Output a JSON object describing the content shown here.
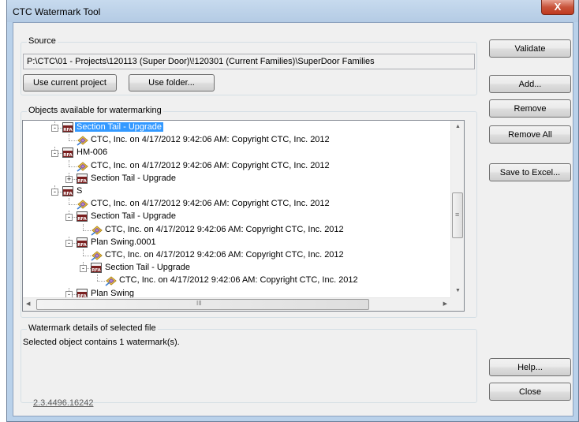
{
  "window": {
    "title": "CTC Watermark Tool",
    "close_glyph": "X"
  },
  "source": {
    "group_label": "Source",
    "path": "P:\\CTC\\01 - Projects\\120113 (Super Door)\\!120301 (Current Families)\\SuperDoor Families",
    "use_current_project_label": "Use current project",
    "use_folder_label": "Use folder..."
  },
  "objects": {
    "group_label": "Objects available for watermarking",
    "tree": [
      {
        "text": "Section Tail - Upgrade",
        "type": "rfa",
        "level": 0,
        "expander": "-",
        "selected": true
      },
      {
        "text": "CTC, Inc. on 4/17/2012 9:42:06 AM: Copyright CTC, Inc. 2012",
        "type": "wm",
        "level": 1
      },
      {
        "text": "HM-006",
        "type": "rfa",
        "level": 0,
        "expander": "-"
      },
      {
        "text": "CTC, Inc. on 4/17/2012 9:42:06 AM: Copyright CTC, Inc. 2012",
        "type": "wm",
        "level": 1
      },
      {
        "text": "Section Tail - Upgrade",
        "type": "rfa",
        "level": 1,
        "expander": "+"
      },
      {
        "text": "S",
        "type": "rfa",
        "level": 0,
        "expander": "-"
      },
      {
        "text": "CTC, Inc. on 4/17/2012 9:42:06 AM: Copyright CTC, Inc. 2012",
        "type": "wm",
        "level": 1
      },
      {
        "text": "Section Tail - Upgrade",
        "type": "rfa",
        "level": 1,
        "expander": "-"
      },
      {
        "text": "CTC, Inc. on 4/17/2012 9:42:06 AM: Copyright CTC, Inc. 2012",
        "type": "wm",
        "level": 2
      },
      {
        "text": "Plan Swing.0001",
        "type": "rfa",
        "level": 1,
        "expander": "-"
      },
      {
        "text": "CTC, Inc. on 4/17/2012 9:42:06 AM: Copyright CTC, Inc. 2012",
        "type": "wm",
        "level": 2
      },
      {
        "text": "Section Tail - Upgrade",
        "type": "rfa",
        "level": 2,
        "expander": "-"
      },
      {
        "text": "CTC, Inc. on 4/17/2012 9:42:06 AM: Copyright CTC, Inc. 2012",
        "type": "wm",
        "level": 3
      },
      {
        "text": "Plan Swing",
        "type": "rfa",
        "level": 1,
        "expander": "-"
      }
    ],
    "hscroll_grip": "III",
    "vscroll_grip": "≡"
  },
  "details": {
    "group_label": "Watermark details of selected file",
    "text": "Selected object contains 1 watermark(s)."
  },
  "buttons": {
    "validate": "Validate",
    "add": "Add...",
    "remove": "Remove",
    "remove_all": "Remove All",
    "save_to_excel": "Save to Excel...",
    "help": "Help...",
    "close": "Close"
  },
  "version": "2.3.4496.16242",
  "icons": {
    "rfa": "rfa-file-icon",
    "watermark": "watermark-icon"
  }
}
